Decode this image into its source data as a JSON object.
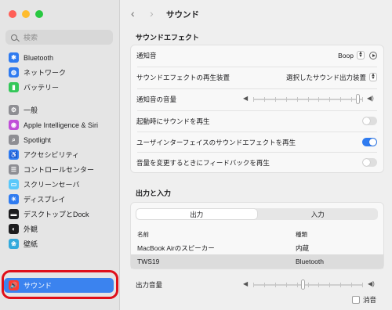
{
  "window": {
    "traffic_colors": [
      "#ff5f57",
      "#febc2e",
      "#28c840"
    ]
  },
  "sidebar": {
    "search_placeholder": "検索",
    "items": [
      {
        "label": "Bluetooth",
        "icon": "bluetooth-icon",
        "color": "#2f7bf0",
        "glyph": "✱"
      },
      {
        "label": "ネットワーク",
        "icon": "network-icon",
        "color": "#2f7bf0",
        "glyph": "◍"
      },
      {
        "label": "バッテリー",
        "icon": "battery-icon",
        "color": "#34c759",
        "glyph": "▮"
      },
      {
        "label": "一般",
        "icon": "general-icon",
        "color": "#8e8e93",
        "glyph": "⚙"
      },
      {
        "label": "Apple Intelligence & Siri",
        "icon": "siri-icon",
        "color": "#c04fd8",
        "glyph": "◉"
      },
      {
        "label": "Spotlight",
        "icon": "spotlight-icon",
        "color": "#8e8e93",
        "glyph": "⌕"
      },
      {
        "label": "アクセシビリティ",
        "icon": "accessibility-icon",
        "color": "#2f7bf0",
        "glyph": "♿"
      },
      {
        "label": "コントロールセンター",
        "icon": "control-center-icon",
        "color": "#8e8e93",
        "glyph": "☰"
      },
      {
        "label": "スクリーンセーバ",
        "icon": "screensaver-icon",
        "color": "#5ac8fa",
        "glyph": "▭"
      },
      {
        "label": "ディスプレイ",
        "icon": "display-icon",
        "color": "#2f7bf0",
        "glyph": "☀"
      },
      {
        "label": "デスクトップとDock",
        "icon": "desktop-dock-icon",
        "color": "#1d1d1f",
        "glyph": "▬"
      },
      {
        "label": "外観",
        "icon": "appearance-icon",
        "color": "#1d1d1f",
        "glyph": "◐"
      },
      {
        "label": "壁紙",
        "icon": "wallpaper-icon",
        "color": "#34aadc",
        "glyph": "❀"
      },
      {
        "label": "サウンド",
        "icon": "sound-icon",
        "color": "#ff3b30",
        "glyph": "🔊"
      }
    ],
    "highlight_color": "#e0101a"
  },
  "main": {
    "title": "サウンド",
    "back_icon": "‹",
    "forward_icon": "›",
    "effects": {
      "section_title": "サウンドエフェクト",
      "alert_sound_label": "通知音",
      "alert_sound_value": "Boop",
      "play_device_label": "サウンドエフェクトの再生装置",
      "play_device_value": "選択したサウンド出力装置",
      "alert_volume_label": "通知音の音量",
      "alert_volume_level": 0.97,
      "startup_label": "起動時にサウンドを再生",
      "startup_on": false,
      "ui_effects_label": "ユーザインターフェイスのサウンドエフェクトを再生",
      "ui_effects_on": true,
      "feedback_label": "音量を変更するときにフィードバックを再生",
      "feedback_on": false
    },
    "io": {
      "section_title": "出力と入力",
      "tabs": [
        "出力",
        "入力"
      ],
      "selected_tab": 0,
      "col_name": "名前",
      "col_type": "種類",
      "devices": [
        {
          "name": "MacBook Airのスピーカー",
          "type": "内蔵"
        },
        {
          "name": "TWS19",
          "type": "Bluetooth"
        }
      ],
      "selected_device": 1
    },
    "output_volume_label": "出力音量",
    "output_volume_level": 0.45,
    "mute_label": "消音"
  },
  "colors": {
    "accent": "#2f7bf0",
    "selection": "#3b83ef"
  }
}
